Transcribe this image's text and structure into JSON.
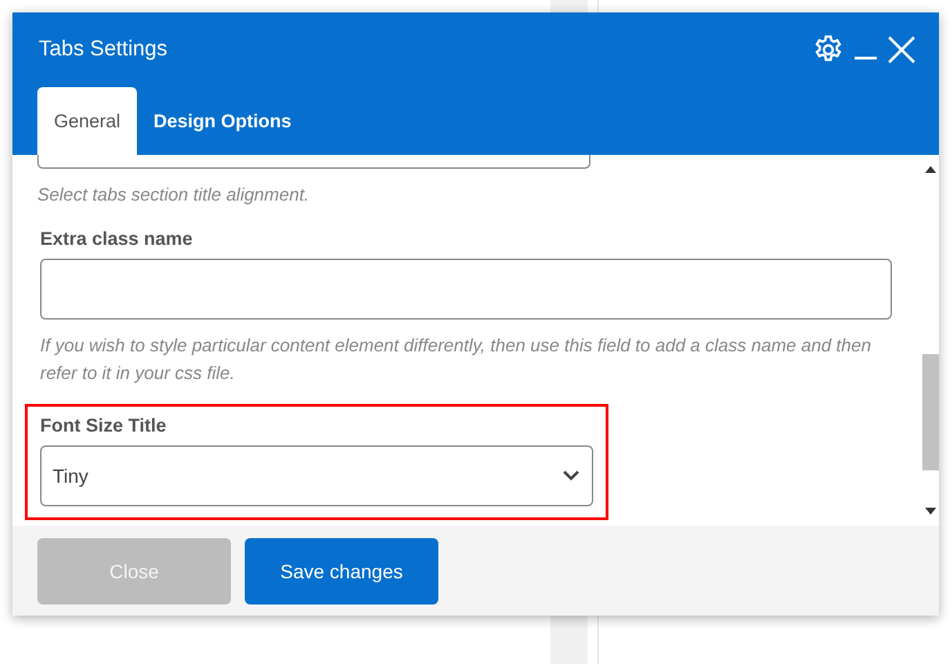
{
  "dialog": {
    "title": "Tabs Settings"
  },
  "tabs": [
    {
      "label": "General",
      "selected": true
    },
    {
      "label": "Design Options",
      "selected": false
    }
  ],
  "fields": [
    {
      "kind": "cut",
      "help": "Select tabs section title alignment."
    },
    {
      "kind": "text",
      "label": "Extra class name",
      "help": "If you wish to style particular content element differently, then use this field to add a class name and then refer to it in your css file.",
      "highlighted": false
    },
    {
      "kind": "select",
      "label": "Font Size Title",
      "value": "Tiny",
      "highlighted": true
    }
  ],
  "buttons": [
    {
      "label": "Close",
      "kind": "secondary"
    },
    {
      "label": "Save changes",
      "kind": "primary"
    }
  ]
}
